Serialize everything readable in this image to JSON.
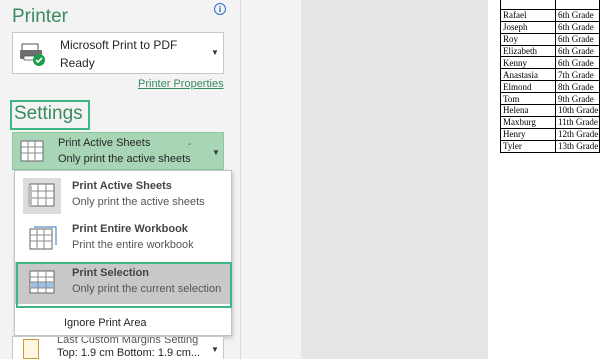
{
  "printer": {
    "title": "Printer",
    "name": "Microsoft Print to PDF",
    "status": "Ready",
    "properties_link": "Printer Properties",
    "info_glyph": "i"
  },
  "settings": {
    "title": "Settings",
    "selected": {
      "label": "Print Active Sheets",
      "description": "Only print the active sheets"
    },
    "options": [
      {
        "label": "Print Active Sheets",
        "description": "Only print the active sheets"
      },
      {
        "label": "Print Entire Workbook",
        "description": "Print the entire workbook"
      },
      {
        "label": "Print Selection",
        "description": "Only print the current selection"
      }
    ],
    "ignore_print_area": "Ignore Print Area",
    "margins": {
      "label": "Last Custom Margins Setting",
      "value": "Top: 1.9 cm Bottom: 1.9 cm..."
    }
  },
  "preview": {
    "rows": [
      {
        "name": "",
        "grade": ""
      },
      {
        "name": "Rafael",
        "grade": "6th Grade"
      },
      {
        "name": "Joseph",
        "grade": "6th Grade"
      },
      {
        "name": "Roy",
        "grade": "6th Grade"
      },
      {
        "name": "Elizabeth",
        "grade": "6th Grade"
      },
      {
        "name": "Kenny",
        "grade": "6th Grade"
      },
      {
        "name": "Anastasia",
        "grade": "7th Grade"
      },
      {
        "name": "Elmond",
        "grade": "8th Grade"
      },
      {
        "name": "Tom",
        "grade": "9th Grade"
      },
      {
        "name": "Helena",
        "grade": "10th Grade"
      },
      {
        "name": "Maxburg",
        "grade": "11th Grade"
      },
      {
        "name": "Henry",
        "grade": "12th Grade"
      },
      {
        "name": "Tyler",
        "grade": "13th Grade"
      }
    ]
  },
  "colors": {
    "accent_green": "#3a8a5f",
    "highlight_box": "#3fb783",
    "selected_button": "#a8d5b6"
  }
}
